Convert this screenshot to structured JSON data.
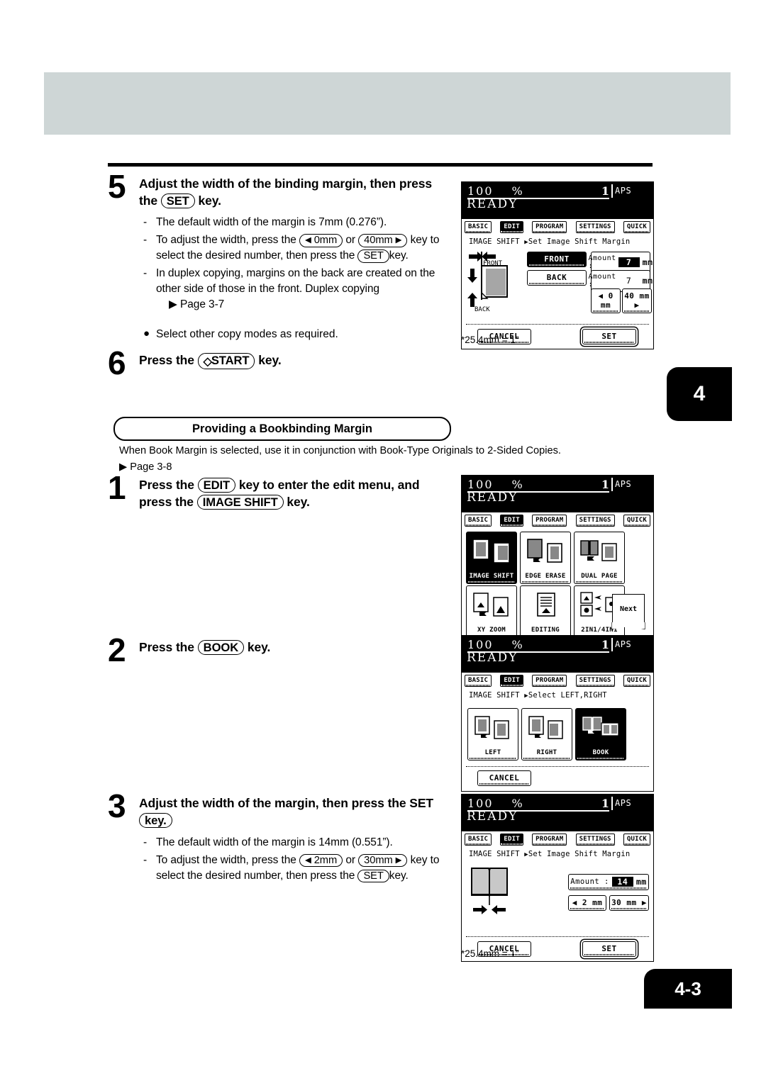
{
  "page": {
    "chapter_tab": "4",
    "page_number": "4-3"
  },
  "steps": {
    "step5": {
      "num": "5",
      "head_line1": "Adjust the width of the binding margin, then press",
      "head_line2_pre": "the",
      "head_key": "SET",
      "head_line2_post": "key.",
      "bullets": [
        "The default width of the margin is 7mm (0.276”).",
        "To adjust the width, press the",
        "In duplex copying, margins on the back are created on the other side of those in the front. Duplex copying"
      ],
      "b2_key_left": "0mm",
      "b2_or": "or",
      "b2_key_right": "40mm",
      "b2_mid": "key to select the desired number, then press the",
      "b2_key_set": "SET",
      "b2_end": "key.",
      "b3_ref": "Page 3-7",
      "note": "Select other copy modes as required."
    },
    "step6": {
      "num": "6",
      "pre": "Press the",
      "key": "START",
      "post": "key."
    },
    "step1": {
      "num": "1",
      "line1_pre": "Press the",
      "key1": "EDIT",
      "line1_post": "key to enter the edit menu, and",
      "line2_pre": "press the",
      "key2": "IMAGE SHIFT",
      "line2_post": "key."
    },
    "step2": {
      "num": "2",
      "pre": "Press the",
      "key": "BOOK",
      "post": "key."
    },
    "step3": {
      "num": "3",
      "head_line1": "Adjust the width of the margin, then press the SET",
      "head_key": "key.",
      "bullets": [
        "The default width of the margin is 14mm (0.551”).",
        "To adjust the width, press the"
      ],
      "b2_key_left": "2mm",
      "b2_or": "or",
      "b2_key_right": "30mm",
      "b2_mid": "key to select the desired number, then press the",
      "b2_key_set": "SET",
      "b2_end": "key."
    }
  },
  "section": {
    "title": "Providing a Bookbinding Margin",
    "lede": "When Book Margin is selected, use it in conjunction with Book-Type Originals to 2-Sided Copies.",
    "ref": "Page 3-8"
  },
  "footnote": "*25.4mm = 1”",
  "lcd_common": {
    "ratio": "100",
    "percent": "%",
    "copies": "1",
    "paper_mode": "APS",
    "status": "READY",
    "tabs": [
      {
        "label": "BASIC",
        "selected": false
      },
      {
        "label": "EDIT",
        "selected": true
      },
      {
        "label": "PROGRAM",
        "selected": false
      },
      {
        "label": "SETTINGS",
        "selected": false
      },
      {
        "label": "QUICK",
        "selected": false
      }
    ]
  },
  "panel1": {
    "path_main": "IMAGE SHIFT",
    "path_sub": "Set Image Shift Margin",
    "diagram_label_top": "FRONT",
    "diagram_label_bottom": "BACK",
    "side_buttons": [
      {
        "label": "FRONT",
        "selected": true
      },
      {
        "label": "BACK",
        "selected": false
      }
    ],
    "amount_label": "Amount :",
    "amount_front": "7",
    "amount_back": "7",
    "unit": "mm",
    "dec_button": "0 mm",
    "inc_button": "40 mm",
    "cancel": "CANCEL",
    "set": "SET"
  },
  "panel2": {
    "tiles": [
      {
        "label": "IMAGE SHIFT",
        "icon": "image-shift-icon",
        "selected": true
      },
      {
        "label": "EDGE ERASE",
        "icon": "edge-erase-icon",
        "selected": false
      },
      {
        "label": "DUAL PAGE",
        "icon": "dual-page-icon",
        "selected": false
      },
      {
        "label": "XY ZOOM",
        "icon": "xy-zoom-icon",
        "selected": false
      },
      {
        "label": "EDITING",
        "icon": "editing-icon",
        "selected": false
      },
      {
        "label": "2IN1/4IN1",
        "icon": "nin1-icon",
        "selected": false
      }
    ],
    "next": "Next"
  },
  "panel3": {
    "path_main": "IMAGE SHIFT",
    "path_sub": "Select LEFT,RIGHT",
    "tiles": [
      {
        "label": "LEFT",
        "icon": "shift-left-icon",
        "selected": false
      },
      {
        "label": "RIGHT",
        "icon": "shift-right-icon",
        "selected": false
      },
      {
        "label": "BOOK",
        "icon": "book-margin-icon",
        "selected": true
      }
    ],
    "cancel": "CANCEL"
  },
  "panel4": {
    "path_main": "IMAGE SHIFT",
    "path_sub": "Set Image Shift Margin",
    "amount_label": "Amount :",
    "amount_value": "14",
    "unit": "mm",
    "dec_button": "2 mm",
    "inc_button": "30 mm",
    "cancel": "CANCEL",
    "set": "SET"
  }
}
